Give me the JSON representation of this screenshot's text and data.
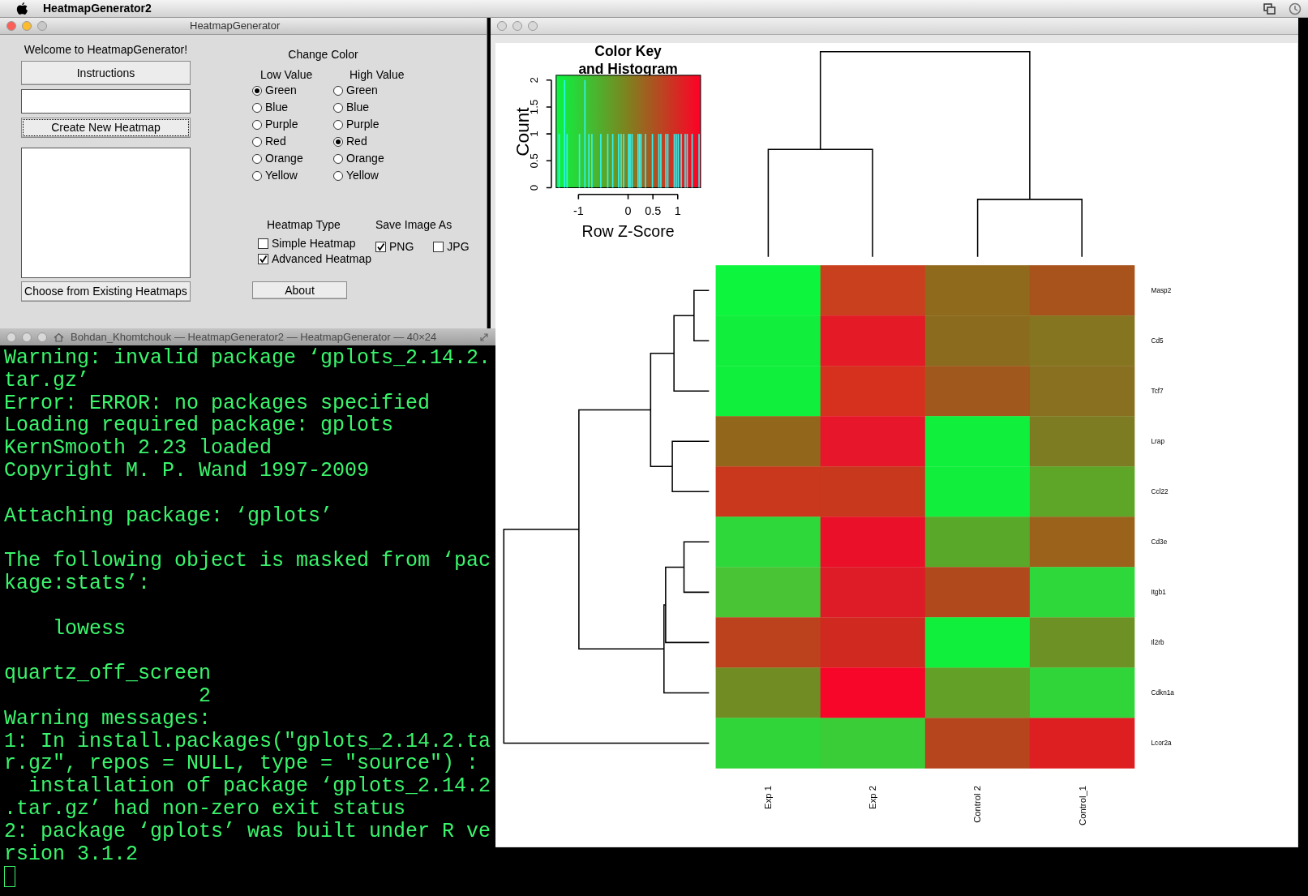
{
  "menu_bar": {
    "app_name": "HeatmapGenerator2"
  },
  "control_window": {
    "title": "HeatmapGenerator",
    "welcome": "Welcome to HeatmapGenerator!",
    "instructions_button": "Instructions",
    "create_button": "Create New Heatmap",
    "choose_button": "Choose from Existing Heatmaps",
    "change_color": {
      "title": "Change Color",
      "columns": [
        {
          "heading": "Low Value",
          "options": [
            {
              "label": "Green",
              "selected": true
            },
            {
              "label": "Blue",
              "selected": false
            },
            {
              "label": "Purple",
              "selected": false
            },
            {
              "label": "Red",
              "selected": false
            },
            {
              "label": "Orange",
              "selected": false
            },
            {
              "label": "Yellow",
              "selected": false
            }
          ]
        },
        {
          "heading": "High Value",
          "options": [
            {
              "label": "Green",
              "selected": false
            },
            {
              "label": "Blue",
              "selected": false
            },
            {
              "label": "Purple",
              "selected": false
            },
            {
              "label": "Red",
              "selected": true
            },
            {
              "label": "Orange",
              "selected": false
            },
            {
              "label": "Yellow",
              "selected": false
            }
          ]
        }
      ]
    },
    "heatmap_type": {
      "heading": "Heatmap Type",
      "options": [
        {
          "label": "Simple Heatmap",
          "checked": false
        },
        {
          "label": "Advanced Heatmap",
          "checked": true
        }
      ]
    },
    "save_image_as": {
      "heading": "Save Image As",
      "options": [
        {
          "label": "PNG",
          "checked": true
        },
        {
          "label": "JPG",
          "checked": false
        }
      ]
    },
    "about_button": "About"
  },
  "terminal": {
    "title": "Bohdan_Khomtchouk — HeatmapGenerator2 — HeatmapGenerator — 40×24",
    "blocks": [
      [
        "Warning: invalid package ‘gplots_2.14.2.",
        "tar.gz’",
        "Error: ERROR: no packages specified",
        "Loading required package: gplots",
        "KernSmooth 2.23 loaded",
        "Copyright M. P. Wand 1997-2009"
      ],
      [
        "Attaching package: ‘gplots’"
      ],
      [
        "The following object is masked from ‘pac",
        "kage:stats’:"
      ],
      [
        "    lowess"
      ],
      [
        "quartz_off_screen",
        "                2",
        "Warning messages:",
        "1: In install.packages(\"gplots_2.14.2.ta",
        "r.gz\", repos = NULL, type = \"source\") :",
        "  installation of package ‘gplots_2.14.2",
        ".tar.gz’ had non-zero exit status",
        "2: package ‘gplots’ was built under R ve",
        "rsion 3.1.2"
      ]
    ]
  },
  "plot_window": {
    "color_key": {
      "chart_data": {
        "type": "bar",
        "title": "Color Key\nand Histogram",
        "xlabel": "Row Z-Score",
        "ylabel": "Count",
        "x": [
          -1.39,
          -1.28,
          -1.23,
          -0.98,
          -0.87,
          -0.79,
          -0.73,
          -0.55,
          -0.41,
          -0.31,
          -0.19,
          -0.14,
          -0.09,
          0.01,
          0.04,
          0.08,
          0.2,
          0.23,
          0.26,
          0.35,
          0.49,
          0.62,
          0.66,
          0.76,
          0.8,
          0.93,
          0.97,
          1.01,
          1.07,
          1.15,
          1.19,
          1.29,
          1.43
        ],
        "values": [
          1,
          2,
          1,
          1,
          2,
          1,
          1,
          1,
          1,
          1,
          1,
          1,
          1,
          1,
          1,
          1,
          1,
          1,
          1,
          1,
          1,
          1,
          1,
          1,
          1,
          1,
          1,
          1,
          1,
          1,
          1,
          1,
          1
        ],
        "xlim": [
          -1.45,
          1.46
        ],
        "ylim": [
          0,
          2.09
        ],
        "xticks": [
          -1,
          0,
          0.5,
          1
        ],
        "yticks": [
          0,
          0.5,
          1,
          1.5,
          2
        ]
      }
    },
    "heatmap": {
      "columns": [
        "Exp 1",
        "Exp 2",
        "Control 2",
        "Control_1"
      ],
      "rows": [
        {
          "label": "Masp2",
          "cells": [
            {
              "color": "#0ef53e"
            },
            {
              "color": "#c9401e"
            },
            {
              "color": "#8f6a1c"
            },
            {
              "color": "#a8521c"
            }
          ]
        },
        {
          "label": "Cd5",
          "cells": [
            {
              "color": "#12ee3c"
            },
            {
              "color": "#e41a26"
            },
            {
              "color": "#8b6c1e"
            },
            {
              "color": "#857520"
            }
          ]
        },
        {
          "label": "Tcf7",
          "cells": [
            {
              "color": "#10ef3c"
            },
            {
              "color": "#d6301f"
            },
            {
              "color": "#a0581c"
            },
            {
              "color": "#887020"
            }
          ]
        },
        {
          "label": "Lrap",
          "cells": [
            {
              "color": "#92671c"
            },
            {
              "color": "#e8162a"
            },
            {
              "color": "#10ef3c"
            },
            {
              "color": "#7d7c22"
            }
          ]
        },
        {
          "label": "Ccl22",
          "cells": [
            {
              "color": "#c9381c"
            },
            {
              "color": "#c8381c"
            },
            {
              "color": "#12ee3c"
            },
            {
              "color": "#5da628"
            }
          ]
        },
        {
          "label": "Cd3e",
          "cells": [
            {
              "color": "#2ed83a"
            },
            {
              "color": "#eb1029"
            },
            {
              "color": "#5aa82a"
            },
            {
              "color": "#9b621c"
            }
          ]
        },
        {
          "label": "Itgb1",
          "cells": [
            {
              "color": "#48c434"
            },
            {
              "color": "#dd1c27"
            },
            {
              "color": "#b0491c"
            },
            {
              "color": "#2ed83a"
            }
          ]
        },
        {
          "label": "Il2rb",
          "cells": [
            {
              "color": "#bb421c"
            },
            {
              "color": "#d0291f"
            },
            {
              "color": "#10ef3c"
            },
            {
              "color": "#6e9126"
            }
          ]
        },
        {
          "label": "Cdkn1a",
          "cells": [
            {
              "color": "#728c24"
            },
            {
              "color": "#f8052a"
            },
            {
              "color": "#62a028"
            },
            {
              "color": "#30d53a"
            }
          ]
        },
        {
          "label": "Lcor2a",
          "cells": [
            {
              "color": "#30d53a"
            },
            {
              "color": "#3acd37"
            },
            {
              "color": "#b6441c"
            },
            {
              "color": "#de1f22"
            }
          ]
        }
      ]
    }
  }
}
